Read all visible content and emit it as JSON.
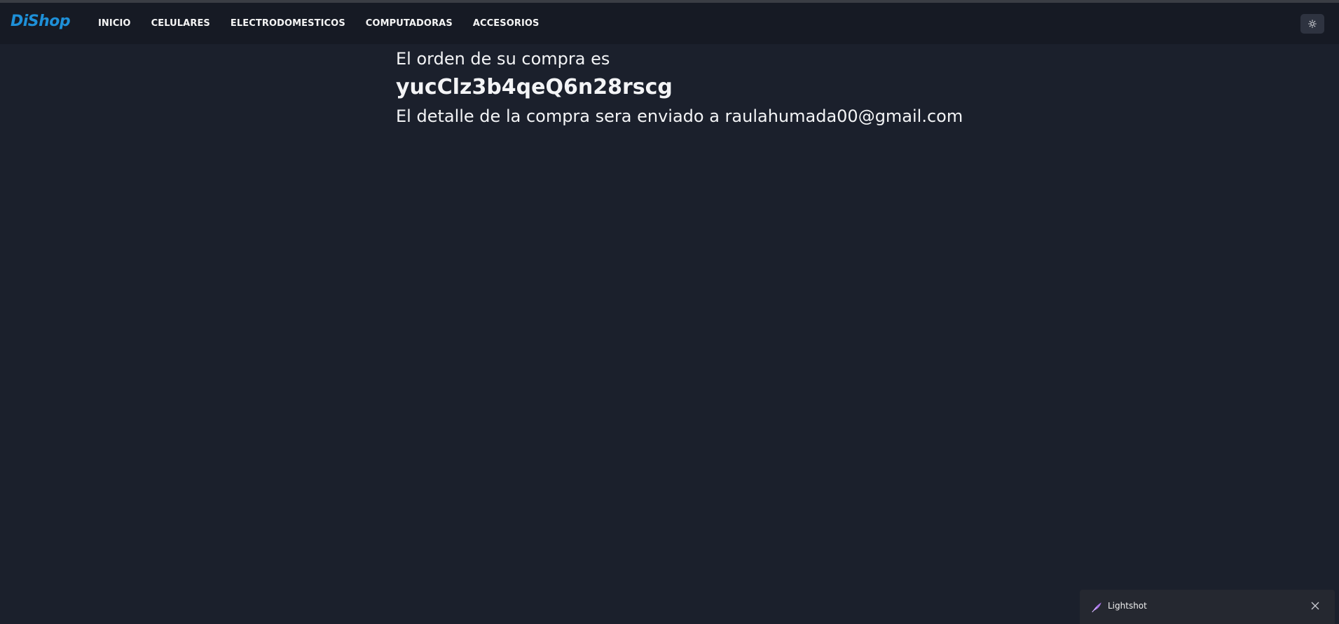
{
  "header": {
    "brand": "DiShop",
    "nav_items": [
      "INICIO",
      "CELULARES",
      "ELECTRODOMESTICOS",
      "COMPUTADORAS",
      "ACCESORIOS"
    ],
    "theme_toggle_icon": "sun-icon"
  },
  "main": {
    "order_intro": "El orden de su compra es",
    "order_id": "yucClz3b4qeQ6n28rscg",
    "order_detail": "El detalle de la compra sera enviado a raulahumada00@gmail.com"
  },
  "toast": {
    "label": "Lightshot",
    "icon": "feather-icon",
    "close_icon": "close-icon"
  },
  "colors": {
    "background": "#1b202c",
    "navbar": "#161a24",
    "brand": "#1e90d8",
    "text": "#f3f4f6",
    "toast_bg": "#252830"
  }
}
